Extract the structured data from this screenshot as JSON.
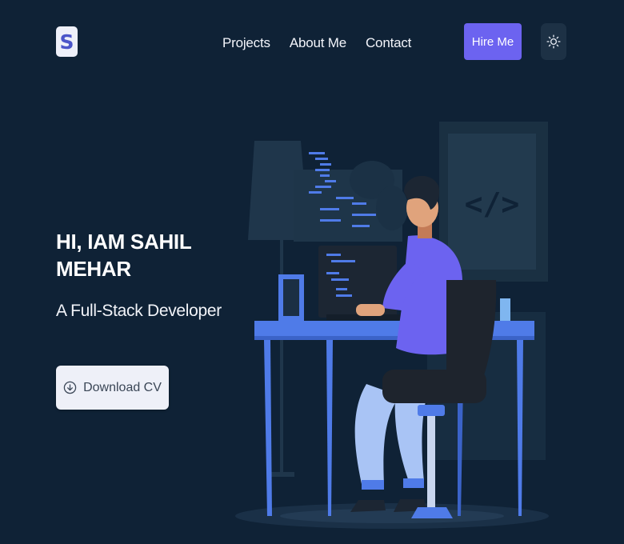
{
  "logo": {
    "letter": "S"
  },
  "nav": {
    "items": [
      "Projects",
      "About Me",
      "Contact"
    ]
  },
  "header": {
    "hire_label": "Hire Me",
    "theme_icon": "sun-icon"
  },
  "hero": {
    "title": "HI, IAM SAHIL MEHAR",
    "subtitle": "A Full-Stack Developer",
    "cv_label": "Download CV",
    "cv_icon": "download-circle-icon"
  },
  "illustration": {
    "code_sign": "</>"
  },
  "colors": {
    "background": "#0f2236",
    "accent": "#6c63f0",
    "desk": "#4f7be8",
    "shirt": "#6c63f0"
  }
}
